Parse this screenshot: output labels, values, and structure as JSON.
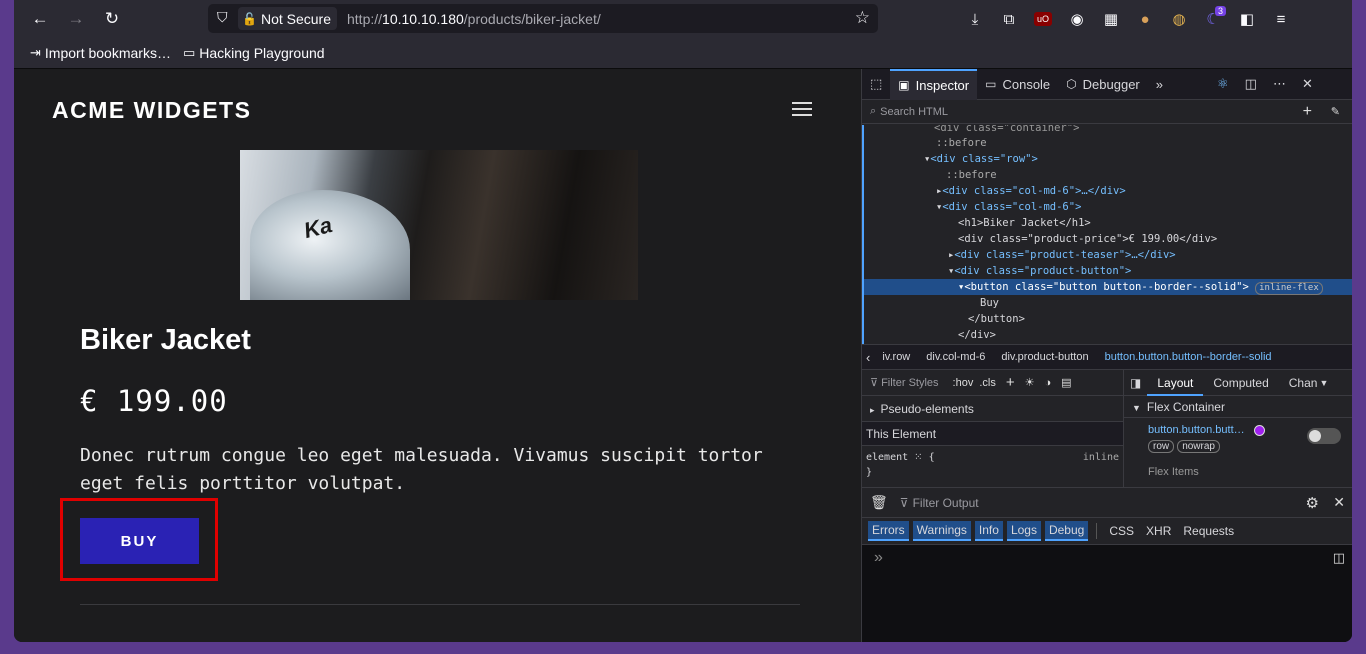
{
  "toolbar": {
    "back_icon": "arrow-left-icon",
    "forward_icon": "arrow-right-icon",
    "reload_icon": "reload-icon",
    "not_secure_label": "Not Secure",
    "url_prefix": "http://",
    "url_host": "10.10.10.180",
    "url_path": "/products/biker-jacket/",
    "extension_badge": "3"
  },
  "bookmarks": [
    {
      "label": "Import bookmarks…"
    },
    {
      "label": "Hacking Playground"
    }
  ],
  "page": {
    "brand": "ACME WIDGETS",
    "product_title": "Biker Jacket",
    "price": "€ 199.00",
    "teaser": "Donec rutrum congue leo eget malesuada. Vivamus suscipit tortor eget felis porttitor volutpat.",
    "buy_label": "BUY",
    "image_text": "Ka"
  },
  "devtools": {
    "tabs": {
      "inspector": "Inspector",
      "console": "Console",
      "debugger": "Debugger"
    },
    "search_placeholder": "Search HTML",
    "markup": [
      "::before",
      "<div class=\"row\">",
      "::before",
      "<div class=\"col-md-6\">…</div>",
      "<div class=\"col-md-6\">",
      "<h1>Biker Jacket</h1>",
      "<div class=\"product-price\">€ 199.00</div>",
      "<div class=\"product-teaser\">…</div>",
      "<div class=\"product-button\">",
      "<button class=\"button button--border--solid\">",
      "Buy",
      "</button>",
      "</div>"
    ],
    "selected_pill": "inline-flex",
    "breadcrumbs": [
      "iv.row",
      "div.col-md-6",
      "div.product-button",
      "button.button.button--border--solid"
    ],
    "rules": {
      "filter_placeholder": "Filter Styles",
      "hov": ":hov",
      "cls": ".cls",
      "pseudo_elements": "Pseudo-elements",
      "this_element": "This Element",
      "element_rule": "element",
      "open_brace": "{",
      "close_brace": "}",
      "inline": "inline"
    },
    "layout": {
      "tabs": [
        "Layout",
        "Computed",
        "Chan"
      ],
      "flex_container": "Flex Container",
      "selector": "button.button.butt…",
      "pill_row": "row",
      "pill_nowrap": "nowrap",
      "flex_items": "Flex Items"
    },
    "console": {
      "filter_placeholder": "Filter Output",
      "filters": [
        "Errors",
        "Warnings",
        "Info",
        "Logs",
        "Debug"
      ],
      "extra": [
        "CSS",
        "XHR",
        "Requests"
      ],
      "prompt": "»"
    }
  }
}
